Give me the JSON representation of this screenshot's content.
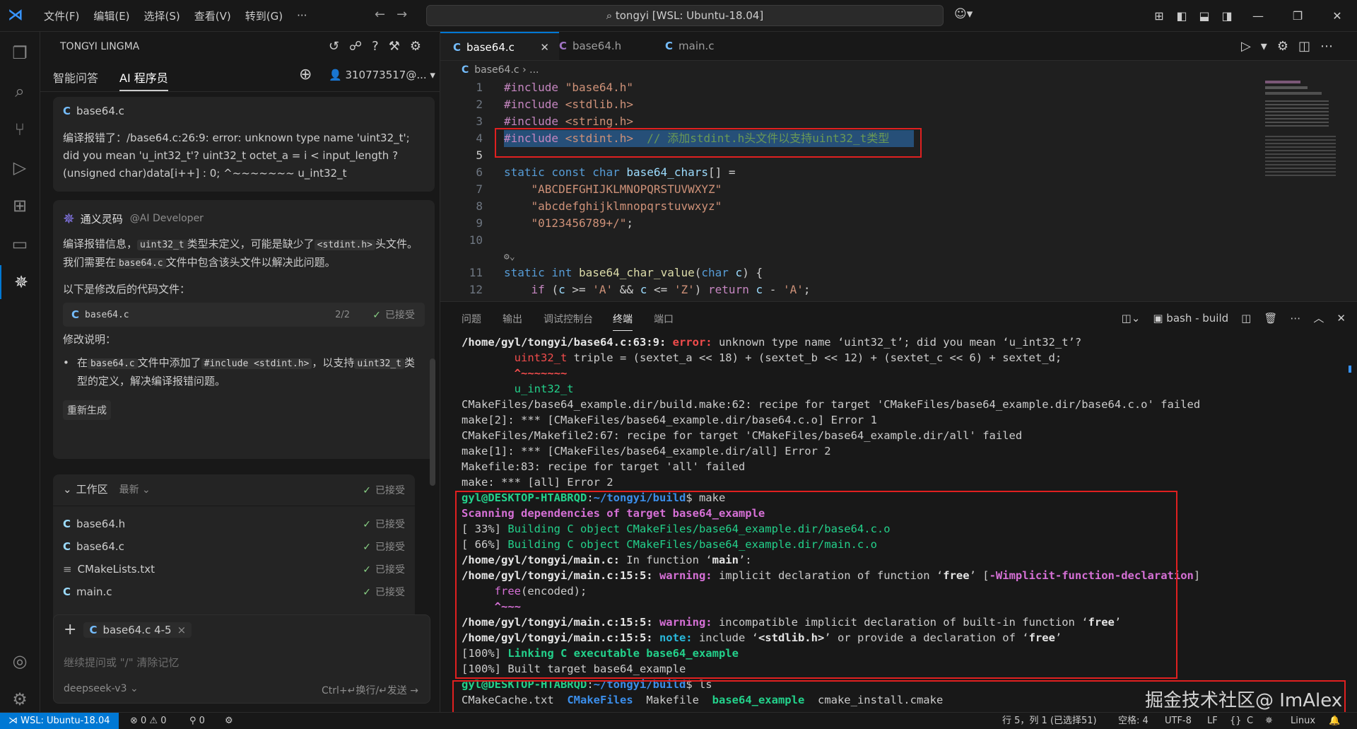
{
  "titlebar": {
    "menu": [
      "文件(F)",
      "编辑(E)",
      "选择(S)",
      "查看(V)",
      "转到(G)",
      "···"
    ],
    "search": "tongyi [WSL: Ubuntu-18.04]"
  },
  "side": {
    "title": "TONGYI LINGMA",
    "tabs": [
      "智能问答",
      "AI 程序员"
    ],
    "account": "310773517@...",
    "chat": {
      "file_chip": "base64.c",
      "user_msg": "编译报错了：/base64.c:26:9: error: unknown type name 'uint32_t'; did you mean 'u_int32_t'? uint32_t octet_a = i < input_length ? (unsigned char)data[i++] : 0; ^~~~~~~~ u_int32_t",
      "bot_name": "通义灵码",
      "bot_tag": "@AI Developer",
      "answer_p1_a": "编译报错信息，",
      "answer_p1_code1": "uint32_t",
      "answer_p1_b": "类型未定义，可能是缺少了",
      "answer_p1_code2": "<stdint.h>",
      "answer_p1_c": "头文件。我们需要在",
      "answer_p1_code3": "base64.c",
      "answer_p1_d": "文件中包含该头文件以解决此问题。",
      "answer_p2": "以下是修改后的代码文件：",
      "result_file": "base64.c",
      "result_count": "2/2",
      "result_status": "已接受",
      "change_title": "修改说明：",
      "bullet_a": "在",
      "bullet_code1": "base64.c",
      "bullet_b": "文件中添加了",
      "bullet_code2": "#include <stdint.h>",
      "bullet_c": "，以支持",
      "bullet_code3": "uint32_t",
      "bullet_d": "类型的定义，解决编译报错问题。",
      "regen": "重新生成"
    },
    "workspace": {
      "title": "工作区",
      "filter": "最新",
      "status": "已接受",
      "files": [
        {
          "name": "base64.h",
          "status": "已接受"
        },
        {
          "name": "base64.c",
          "status": "已接受"
        },
        {
          "name": "CMakeLists.txt",
          "status": "已接受"
        },
        {
          "name": "main.c",
          "status": "已接受"
        }
      ]
    },
    "input": {
      "context_chip": "base64.c 4-5",
      "placeholder": "继续提问或 \"/\" 清除记忆",
      "model": "deepseek-v3",
      "send_hint": "Ctrl+↵换行/↵发送"
    }
  },
  "editor": {
    "tabs": [
      "base64.c",
      "base64.h",
      "main.c"
    ],
    "breadcrumb": "base64.c › ...",
    "lines": [
      {
        "n": "1",
        "code": "#include \"base64.h\""
      },
      {
        "n": "2",
        "code": "#include <stdlib.h>"
      },
      {
        "n": "3",
        "code": "#include <string.h>"
      },
      {
        "n": "4",
        "code": "#include <stdint.h>  // 添加stdint.h头文件以支持uint32_t类型"
      },
      {
        "n": "5",
        "code": ""
      },
      {
        "n": "6",
        "code": "static const char base64_chars[] ="
      },
      {
        "n": "7",
        "code": "    \"ABCDEFGHIJKLMNOPQRSTUVWXYZ\""
      },
      {
        "n": "8",
        "code": "    \"abcdefghijklmnopqrstuvwxyz\""
      },
      {
        "n": "9",
        "code": "    \"0123456789+/\";"
      },
      {
        "n": "10",
        "code": ""
      },
      {
        "n": "11",
        "code": "static int base64_char_value(char c) {"
      },
      {
        "n": "12",
        "code": "    if (c >= 'A' && c <= 'Z') return c - 'A';"
      }
    ]
  },
  "panel": {
    "tabs": [
      "问题",
      "输出",
      "调试控制台",
      "终端",
      "端口"
    ],
    "terminal_name": "bash - build",
    "term": {
      "l1_path": "/home/gyl/tongyi/base64.c:63:9:",
      "l1_err": "error:",
      "l1_rest": " unknown type name ‘uint32_t’; did you mean ‘u_int32_t’?",
      "l2_a": "        ",
      "l2_hl": "uint32_t",
      "l2_rest": " triple = (sextet_a << 18) + (sextet_b << 12) + (sextet_c << 6) + sextet_d;",
      "l3": "        ^~~~~~~~",
      "l4": "        u_int32_t",
      "l5": "CMakeFiles/base64_example.dir/build.make:62: recipe for target 'CMakeFiles/base64_example.dir/base64.c.o' failed",
      "l6": "make[2]: *** [CMakeFiles/base64_example.dir/base64.c.o] Error 1",
      "l7": "CMakeFiles/Makefile2:67: recipe for target 'CMakeFiles/base64_example.dir/all' failed",
      "l8": "make[1]: *** [CMakeFiles/base64_example.dir/all] Error 2",
      "l9": "Makefile:83: recipe for target 'all' failed",
      "l10": "make: *** [all] Error 2",
      "p1_user": "gyl@DESKTOP-HTABRQD",
      "p1_colon": ":",
      "p1_path": "~/tongyi/build",
      "p1_cmd": "$ make",
      "s1": "Scanning dependencies of target base64_example",
      "s2_a": "[ 33%] ",
      "s2_b": "Building C object CMakeFiles/base64_example.dir/base64.c.o",
      "s3_a": "[ 66%] ",
      "s3_b": "Building C object CMakeFiles/base64_example.dir/main.c.o",
      "s4_path": "/home/gyl/tongyi/main.c:",
      "s4_rest": " In function ‘",
      "s4_fn": "main",
      "s4_end": "’:",
      "s5_path": "/home/gyl/tongyi/main.c:15:5:",
      "s5_warn": "warning:",
      "s5_rest": " implicit declaration of function ‘",
      "s5_fn": "free",
      "s5_mid": "’ [",
      "s5_flag": "-Wimplicit-function-declaration",
      "s5_end": "]",
      "s6_a": "     ",
      "s6_fn": "free",
      "s6_rest": "(encoded);",
      "s7": "     ^~~~",
      "s8_path": "/home/gyl/tongyi/main.c:15:5:",
      "s8_warn": "warning:",
      "s8_rest": " incompatible implicit declaration of built-in function ‘",
      "s8_fn": "free",
      "s8_end": "’",
      "s9_path": "/home/gyl/tongyi/main.c:15:5:",
      "s9_note": "note:",
      "s9_rest": " include ‘",
      "s9_inc": "<stdlib.h>",
      "s9_mid": "’ or provide a declaration of ‘",
      "s9_fn": "free",
      "s9_end": "’",
      "s10_a": "[100%] ",
      "s10_b": "Linking C executable base64_example",
      "s11": "[100%] Built target base64_example",
      "p2_user": "gyl@DESKTOP-HTABRQD",
      "p2_colon": ":",
      "p2_path": "~/tongyi/build",
      "p2_cmd": "$ ls",
      "ls_1": "CMakeCache.txt",
      "ls_2": "CMakeFiles",
      "ls_3": "Makefile",
      "ls_4": "base64_example",
      "ls_5": "cmake_install.cmake"
    }
  },
  "status": {
    "remote": "WSL: Ubuntu-18.04",
    "problems": "⊗ 0 ⚠ 0",
    "ports": "0",
    "position": "行 5，列 1 (已选择51)",
    "spaces": "空格: 4",
    "encoding": "UTF-8",
    "eol": "LF",
    "lang": "C",
    "os": "Linux"
  },
  "watermark": "掘金技术社区@ ImAlex"
}
